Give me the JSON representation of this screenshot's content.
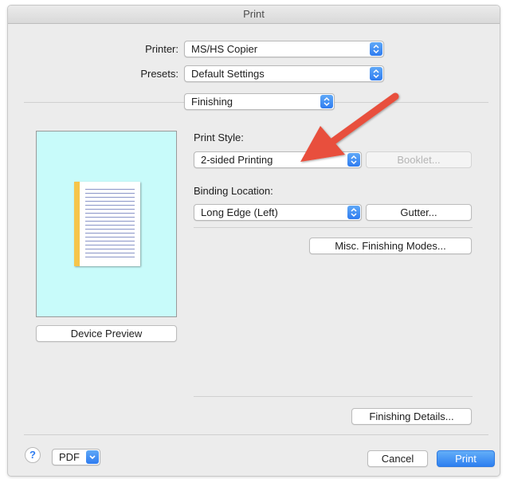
{
  "window": {
    "title": "Print"
  },
  "printer": {
    "label": "Printer:",
    "value": "MS/HS Copier"
  },
  "presets": {
    "label": "Presets:",
    "value": "Default Settings"
  },
  "section": {
    "value": "Finishing"
  },
  "print_style": {
    "label": "Print Style:",
    "value": "2-sided Printing",
    "booklet_label": "Booklet..."
  },
  "binding": {
    "label": "Binding Location:",
    "value": "Long Edge (Left)",
    "gutter_label": "Gutter..."
  },
  "misc_button": "Misc. Finishing Modes...",
  "device_preview_button": "Device Preview",
  "finishing_details_button": "Finishing Details...",
  "footer": {
    "help": "?",
    "pdf_label": "PDF",
    "cancel_label": "Cancel",
    "print_label": "Print"
  },
  "colors": {
    "accent": "#2f7cf0",
    "annotation_arrow": "#e8503c",
    "preview_bg": "#c8fbfa",
    "binding_edge": "#f6c54a"
  }
}
